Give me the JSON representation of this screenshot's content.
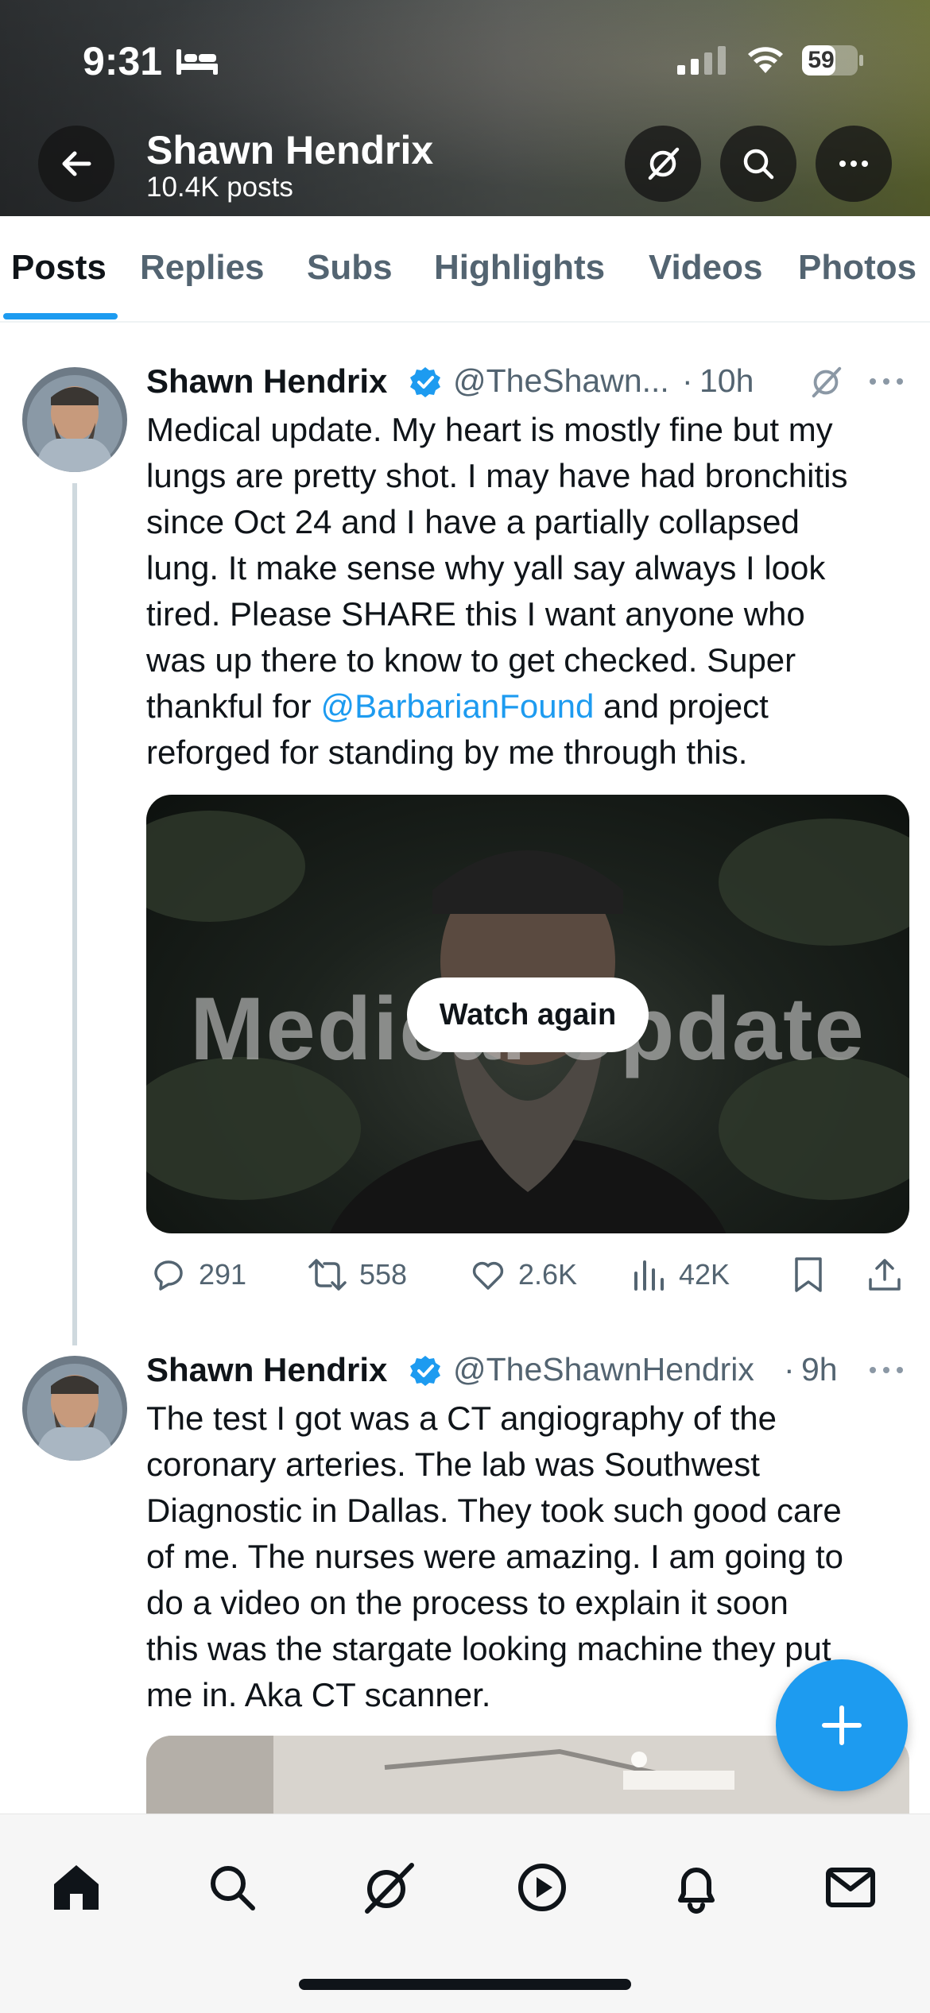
{
  "status_bar": {
    "time": "9:31",
    "battery": "59"
  },
  "header": {
    "title": "Shawn Hendrix",
    "subtitle": "10.4K posts"
  },
  "tabs": [
    {
      "label": "Posts"
    },
    {
      "label": "Replies"
    },
    {
      "label": "Subs"
    },
    {
      "label": "Highlights"
    },
    {
      "label": "Videos"
    },
    {
      "label": "Photos"
    }
  ],
  "posts": [
    {
      "name": "Shawn Hendrix",
      "handle": "@TheShawn...",
      "dot": "·",
      "time": "10h",
      "lines": [
        "Medical update. My heart is mostly fine but my",
        "lungs are pretty shot. I may have had bronchitis",
        "since Oct 24 and I have a partially collapsed",
        "lung. It make sense why yall say always I look",
        "tired. Please SHARE this I want anyone who",
        "was up there to know to get checked. Super"
      ],
      "line7_pre": "thankful for ",
      "mention": "@BarbarianFound",
      "line7_post": " and project",
      "line8": "reforged for standing by me through this.",
      "video_overlay": "Medical Update",
      "watch_again": "Watch again",
      "replies": "291",
      "reposts": "558",
      "likes": "2.6K",
      "views": "42K"
    },
    {
      "name": "Shawn Hendrix",
      "handle": "@TheShawnHendrix",
      "dot": "·",
      "time": "9h",
      "lines": [
        "The test I got was a CT angiography of the",
        "coronary arteries. The lab was Southwest",
        "Diagnostic in Dallas. They took such good care",
        "of me. The nurses were amazing. I am going to",
        "do a video on the process to explain it soon",
        "this was the stargate looking machine they put",
        "me in. Aka CT scanner."
      ]
    }
  ],
  "colors": {
    "accent": "#1d9bf0",
    "text": "#0f1419",
    "secondary": "#536471"
  },
  "icons": {
    "back": "arrow-left-icon",
    "grok": "grok-icon",
    "search": "search-icon",
    "more": "more-icon",
    "verified": "verified-badge-icon",
    "reply": "reply-icon",
    "repost": "repost-icon",
    "like": "heart-icon",
    "views": "views-icon",
    "bookmark": "bookmark-icon",
    "share": "share-icon",
    "compose": "plus-icon",
    "home": "home-icon",
    "explore": "search-icon",
    "grok_nav": "grok-icon",
    "video": "play-icon",
    "notifications": "bell-icon",
    "messages": "mail-icon"
  }
}
